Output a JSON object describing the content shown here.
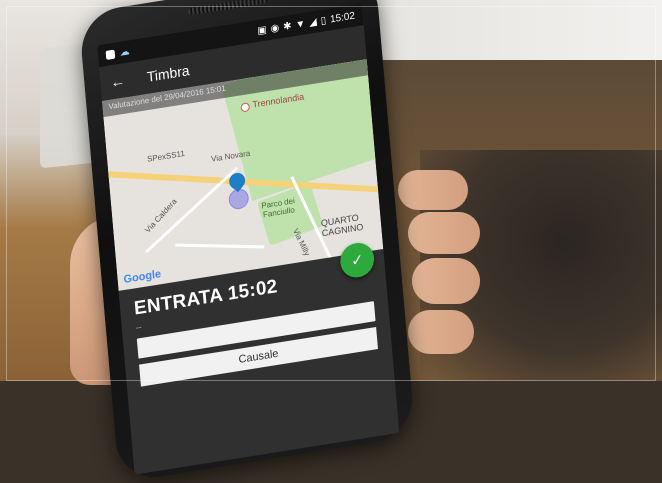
{
  "status_bar": {
    "time": "15:02"
  },
  "app_bar": {
    "title": "Timbra"
  },
  "map": {
    "notice": "Valutazione del 29/04/2016 15:01",
    "labels": {
      "trennolandia": "Trennolandia",
      "spexss11": "SPexSS11",
      "via_novara": "Via Novara",
      "via_caldera": "Via Caldera",
      "parco": "Parco dei\nFanciullo",
      "quarto": "QUARTO\nCAGNINO",
      "via_milly": "Via Milly"
    },
    "attribution": "Google"
  },
  "fab": {
    "icon": "check-icon"
  },
  "entry": {
    "title": "ENTRATA 15:02",
    "subtitle": "--"
  },
  "causale": {
    "label": "Causale"
  },
  "colors": {
    "fab": "#2ea93b",
    "pin": "#1e7fc7",
    "park": "#bfe2ac",
    "road": "#f5d27a"
  }
}
